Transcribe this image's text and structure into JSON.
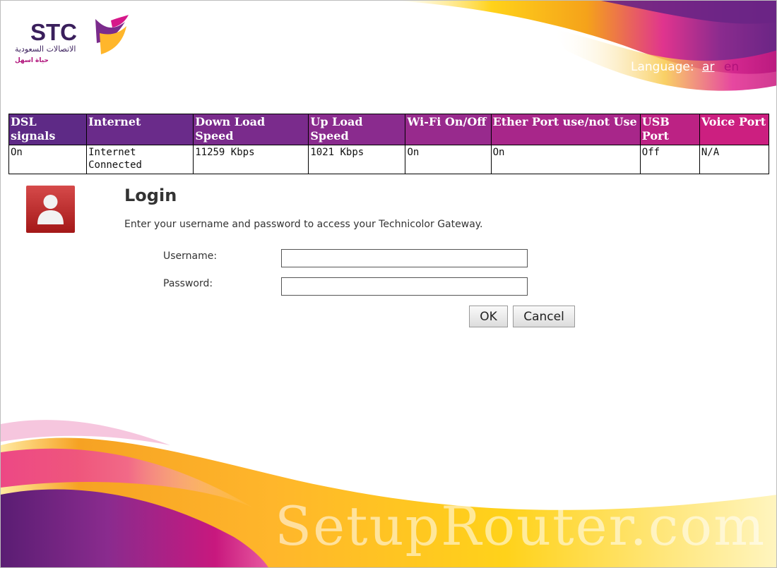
{
  "brand": {
    "name": "STC",
    "arabic_name": "الاتصالات السعودية",
    "tagline": "حياة اسهل"
  },
  "language": {
    "label": "Language:",
    "options": [
      "ar",
      "en"
    ],
    "selected": "en"
  },
  "status_table": {
    "headers": [
      "DSL signals",
      "Internet",
      "Down Load Speed",
      "Up Load Speed",
      "Wi-Fi On/Off",
      "Ether Port use/not Use",
      "USB Port",
      "Voice Port"
    ],
    "values": [
      "On",
      "Internet Connected",
      "11259 Kbps",
      "1021 Kbps",
      "On",
      "On",
      "Off",
      "N/A"
    ]
  },
  "login": {
    "title": "Login",
    "description": "Enter your username and password to access your Technicolor Gateway.",
    "username_label": "Username:",
    "password_label": "Password:",
    "username_value": "",
    "password_value": "",
    "ok_label": "OK",
    "cancel_label": "Cancel"
  },
  "watermark": "SetupRouter.com",
  "colors": {
    "purple": "#7b2b8c",
    "magenta": "#d6188a",
    "orange": "#f5a21a",
    "yellow": "#ffd21a",
    "avatar_red": "#b72020"
  },
  "icons": {
    "avatar": "user-silhouette-icon",
    "logo_mark": "stc-bird-logo-icon"
  }
}
